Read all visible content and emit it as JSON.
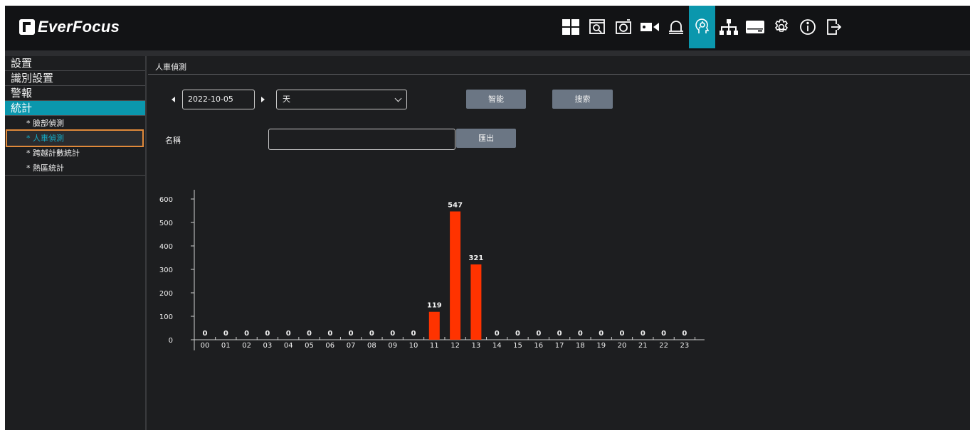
{
  "app": {
    "logo_text": "EverFocus"
  },
  "topnav": {
    "items": [
      {
        "icon": "live-view-icon",
        "active": false
      },
      {
        "icon": "playback-search-icon",
        "active": false
      },
      {
        "icon": "snapshot-icon",
        "active": false
      },
      {
        "icon": "camera-icon",
        "active": false
      },
      {
        "icon": "alarm-bell-icon",
        "active": false
      },
      {
        "icon": "ai-intelligence-icon",
        "active": true
      },
      {
        "icon": "network-icon",
        "active": false
      },
      {
        "icon": "storage-hdd-icon",
        "active": false
      },
      {
        "icon": "settings-gear-icon",
        "active": false
      },
      {
        "icon": "info-icon",
        "active": false
      },
      {
        "icon": "logout-icon",
        "active": false
      }
    ],
    "accent": "#0b97ad"
  },
  "sidebar": {
    "items": [
      {
        "label": "設置"
      },
      {
        "label": "識別設置"
      },
      {
        "label": "警報"
      },
      {
        "label": "統計",
        "active": true
      }
    ],
    "subitems": [
      {
        "label": "* 臉部偵測"
      },
      {
        "label": "* 人車偵測",
        "active": true
      },
      {
        "label": "* 跨越計數統計"
      },
      {
        "label": "* 熱區統計"
      }
    ]
  },
  "main": {
    "breadcrumb": "人車偵測",
    "date": "2022-10-05",
    "period": "天",
    "smart_label": "智能",
    "search_label": "搜索",
    "name_label": "名稱",
    "name_value": "",
    "export_label": "匯出"
  },
  "chart_data": {
    "type": "bar",
    "categories": [
      "00",
      "01",
      "02",
      "03",
      "04",
      "05",
      "06",
      "07",
      "08",
      "09",
      "10",
      "11",
      "12",
      "13",
      "14",
      "15",
      "16",
      "17",
      "18",
      "19",
      "20",
      "21",
      "22",
      "23"
    ],
    "values": [
      0,
      0,
      0,
      0,
      0,
      0,
      0,
      0,
      0,
      0,
      0,
      119,
      547,
      321,
      0,
      0,
      0,
      0,
      0,
      0,
      0,
      0,
      0,
      0
    ],
    "yticks": [
      0,
      100,
      200,
      300,
      400,
      500,
      600
    ],
    "ylim": [
      0,
      600
    ],
    "bar_color": "#ff3300",
    "title": "",
    "xlabel": "",
    "ylabel": ""
  }
}
